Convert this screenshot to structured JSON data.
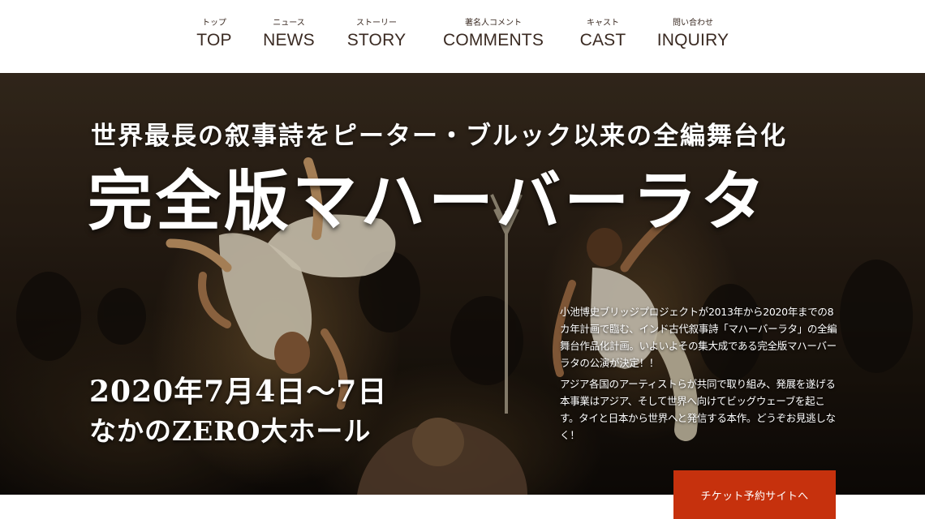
{
  "nav": {
    "items": [
      {
        "ruby": "トップ",
        "label": "TOP"
      },
      {
        "ruby": "ニュース",
        "label": "NEWS"
      },
      {
        "ruby": "ストーリー",
        "label": "STORY"
      },
      {
        "ruby": "著名人コメント",
        "label": "COMMENTS"
      },
      {
        "ruby": "キャスト",
        "label": "CAST"
      },
      {
        "ruby": "問い合わせ",
        "label": "INQUIRY"
      }
    ]
  },
  "hero": {
    "subtitle": "世界最長の叙事詩をピーター・ブルック以来の全編舞台化",
    "title": "完全版マハーバーラタ",
    "date": "2020年7月4日～7日",
    "venue": "なかのZERO大ホール",
    "description": [
      "小池博史ブリッジプロジェクトが2013年から2020年までの8カ年計画で臨む、インド古代叙事詩「マハーバーラタ」の全編舞台作品化計画。いよいよその集大成である完全版マハーバーラタの公演が決定！！",
      "アジア各国のアーティストらが共同で取り組み、発展を遂げる本事業はアジア、そして世界へ向けてビッグウェーブを起こす。タイと日本から世界へと発信する本作。どうぞお見逃しなく！"
    ],
    "image_icon": "stage-performance-photo"
  },
  "ticket": {
    "label": "チケット予約サイトへ",
    "color": "#c6310d"
  },
  "colors": {
    "nav_text": "#3a2a22",
    "hero_text": "#ffffff"
  }
}
